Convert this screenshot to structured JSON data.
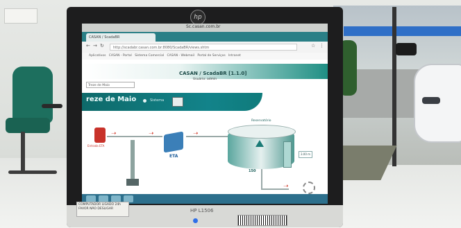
{
  "monitor": {
    "brand_logo": "hp",
    "model_label": "HP L1506",
    "sticker_text": "COMPUTADOR LIGADO 24h FAVOR NÃO DESLIGAR",
    "barcode_text": "",
    "power_led_color": "#2e6fe8"
  },
  "screen": {
    "os_title": "Sc.casan.com.br",
    "browser": {
      "tab_label": "CASAN / ScadaBR",
      "address": "http://scadabr.casan.com.br:8080/ScadaBR/views.shtm",
      "bookmarks": [
        "Aplicativos",
        "CASAN - Portal",
        "Sistema Comercial",
        "CASAN - Webmail",
        "Portal de Serviços",
        "Intranet"
      ]
    },
    "app": {
      "title": "CASAN / ScadaBR [1.1.0]",
      "user_info": "Usuário: admin",
      "view_selector": "Treze de Maio",
      "banner_title": "reze de Maio",
      "banner_subtitle": "Sistema"
    },
    "diagram": {
      "valve_label": "Entrada ETA",
      "treatment_label": "ETA",
      "tank_tag": "Reservatório",
      "tank_level": "150",
      "side_value": "3.00 m",
      "accent_color": "#1b7b76"
    }
  },
  "scene": {
    "chair_color": "#1d6f5e",
    "car_color": "#f4f5f6"
  }
}
